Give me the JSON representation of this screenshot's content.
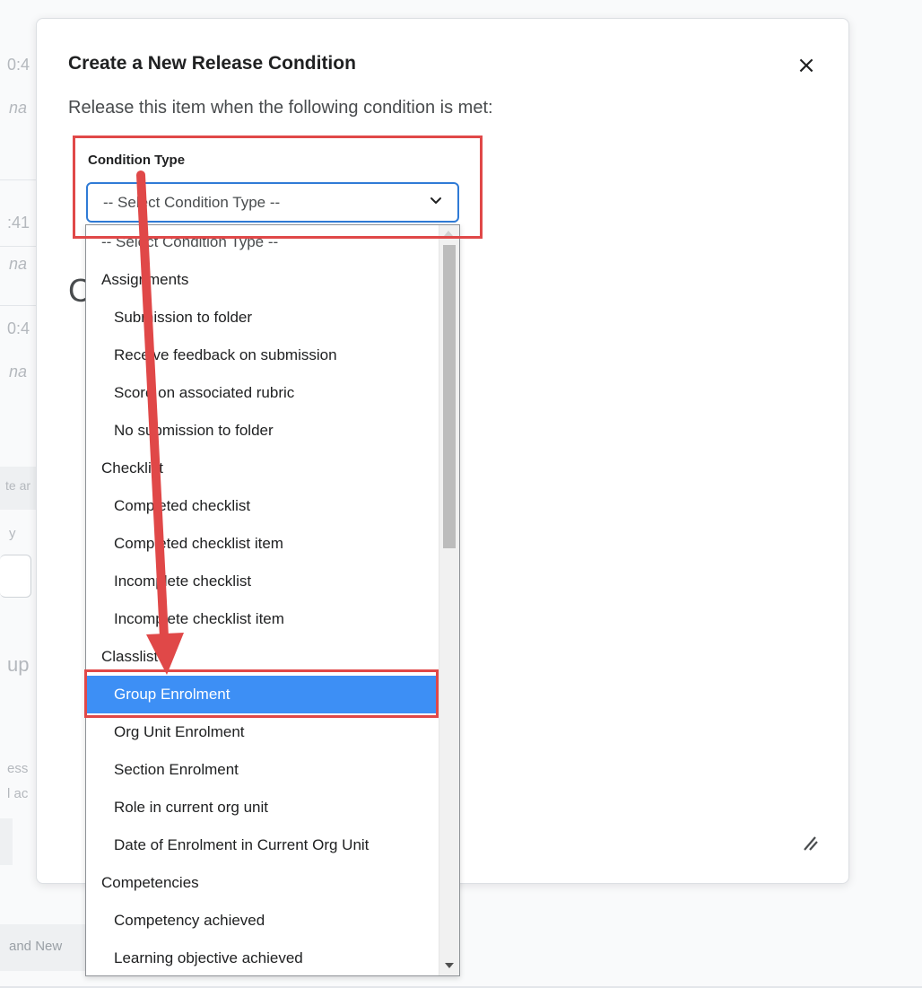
{
  "background": {
    "fragments": [
      {
        "id": "f1",
        "text": "0:4"
      },
      {
        "id": "f2",
        "text": "na"
      },
      {
        "id": "f3",
        "text": ":41"
      },
      {
        "id": "f4",
        "text": "na"
      },
      {
        "id": "f5",
        "text": "0:4"
      },
      {
        "id": "f6",
        "text": "na"
      },
      {
        "id": "f7",
        "text": "te ar"
      },
      {
        "id": "f8",
        "text": "y"
      },
      {
        "id": "f9",
        "text": "up i"
      },
      {
        "id": "f10",
        "text": "ess"
      },
      {
        "id": "f11",
        "text": "l ac"
      }
    ],
    "bottom_button_label": "and New"
  },
  "dialog": {
    "title": "Create a New Release Condition",
    "close_glyph": "×",
    "description": "Release this item when the following condition is met:",
    "partial_heading": "C",
    "field_label": "Condition Type",
    "select_value": "-- Select Condition Type --",
    "dropdown": {
      "selected": "Group Enrolment",
      "options": [
        {
          "label": "-- Select Condition Type --",
          "kind": "placeholder"
        },
        {
          "label": "Assignments",
          "kind": "group"
        },
        {
          "label": "Submission to folder",
          "kind": "child"
        },
        {
          "label": "Receive feedback on submission",
          "kind": "child"
        },
        {
          "label": "Score on associated rubric",
          "kind": "child"
        },
        {
          "label": "No submission to folder",
          "kind": "child"
        },
        {
          "label": "Checklist",
          "kind": "group"
        },
        {
          "label": "Completed checklist",
          "kind": "child"
        },
        {
          "label": "Completed checklist item",
          "kind": "child"
        },
        {
          "label": "Incomplete checklist",
          "kind": "child"
        },
        {
          "label": "Incomplete checklist item",
          "kind": "child"
        },
        {
          "label": "Classlist",
          "kind": "group"
        },
        {
          "label": "Group Enrolment",
          "kind": "child"
        },
        {
          "label": "Org Unit Enrolment",
          "kind": "child"
        },
        {
          "label": "Section Enrolment",
          "kind": "child"
        },
        {
          "label": "Role in current org unit",
          "kind": "child"
        },
        {
          "label": "Date of Enrolment in Current Org Unit",
          "kind": "child"
        },
        {
          "label": "Competencies",
          "kind": "group"
        },
        {
          "label": "Competency achieved",
          "kind": "child"
        },
        {
          "label": "Learning objective achieved",
          "kind": "child"
        }
      ]
    }
  },
  "colors": {
    "annotation": "#e04848",
    "selected_option": "#3d8ff5",
    "select_border": "#2f7bd6"
  },
  "icons": {
    "close": "close-icon",
    "chevron": "chevron-down-icon",
    "resize": "resize-handle-icon",
    "annotation_arrow": "annotation-arrow"
  }
}
